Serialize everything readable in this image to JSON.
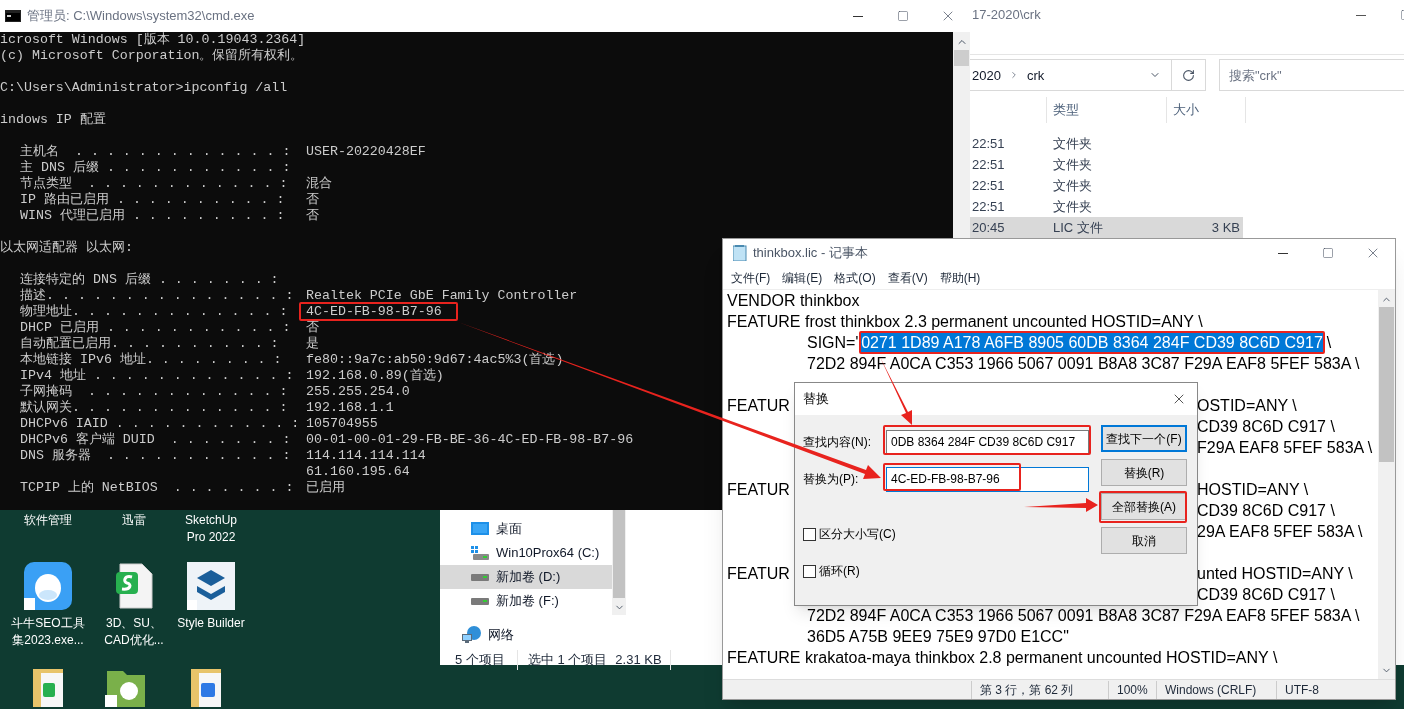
{
  "cmd_window": {
    "title": "管理员: C:\\Windows\\system32\\cmd.exe",
    "lines": [
      {
        "kind": "text",
        "text": "icrosoft Windows [版本 10.0.19043.2364]"
      },
      {
        "kind": "text",
        "text": "(c) Microsoft Corporation。保留所有权利。"
      },
      {
        "kind": "blank"
      },
      {
        "kind": "text",
        "text": "C:\\Users\\Administrator>ipconfig /all"
      },
      {
        "kind": "blank"
      },
      {
        "kind": "text",
        "text": "indows IP 配置"
      },
      {
        "kind": "blank"
      },
      {
        "kind": "field",
        "framed": false,
        "label": "主机名  . . . . . . . . . . . . . :",
        "value": "USER-20220428EF"
      },
      {
        "kind": "field",
        "framed": false,
        "label": "主 DNS 后缀 . . . . . . . . . . . :"
      },
      {
        "kind": "field",
        "framed": false,
        "label": "节点类型  . . . . . . . . . . . . :",
        "value": "混合"
      },
      {
        "kind": "field",
        "framed": false,
        "label": "IP 路由已启用 . . . . . . . . . . :",
        "value": "否"
      },
      {
        "kind": "field",
        "framed": false,
        "label": "WINS 代理已启用 . . . . . . . . . :",
        "value": "否"
      },
      {
        "kind": "blank"
      },
      {
        "kind": "text",
        "text": "以太网适配器 以太网:"
      },
      {
        "kind": "blank"
      },
      {
        "kind": "field",
        "framed": false,
        "label": "连接特定的 DNS 后缀 . . . . . . . :"
      },
      {
        "kind": "field",
        "framed": false,
        "label": "描述. . . . . . . . . . . . . . . :",
        "value": "Realtek PCIe GbE Family Controller"
      },
      {
        "kind": "field",
        "framed": true,
        "label": "物理地址. . . . . . . . . . . . . :",
        "value": "4C-ED-FB-98-B7-96"
      },
      {
        "kind": "field",
        "framed": false,
        "label": "DHCP 已启用 . . . . . . . . . . . :",
        "value": "否"
      },
      {
        "kind": "field",
        "framed": false,
        "label": "自动配置已启用. . . . . . . . . . :",
        "value": "是"
      },
      {
        "kind": "field",
        "framed": false,
        "label": "本地链接 IPv6 地址. . . . . . . . :",
        "value": "fe80::9a7c:ab50:9d67:4ac5%3(首选)"
      },
      {
        "kind": "field",
        "framed": false,
        "label": "IPv4 地址 . . . . . . . . . . . . :",
        "value": "192.168.0.89(首选)"
      },
      {
        "kind": "field",
        "framed": false,
        "label": "子网掩码  . . . . . . . . . . . . :",
        "value": "255.255.254.0"
      },
      {
        "kind": "field",
        "framed": false,
        "label": "默认网关. . . . . . . . . . . . . :",
        "value": "192.168.1.1"
      },
      {
        "kind": "field",
        "framed": false,
        "label": "DHCPv6 IAID . . . . . . . . . . . :",
        "value": "105704955"
      },
      {
        "kind": "field",
        "framed": false,
        "label": "DHCPv6 客户端 DUID  . . . . . . . :",
        "value": "00-01-00-01-29-FB-BE-36-4C-ED-FB-98-B7-96"
      },
      {
        "kind": "field",
        "framed": false,
        "label": "DNS 服务器  . . . . . . . . . . . :",
        "value": "114.114.114.114"
      },
      {
        "kind": "field",
        "framed": false,
        "value": "61.160.195.64"
      },
      {
        "kind": "field",
        "framed": false,
        "label": "TCPIP 上的 NetBIOS  . . . . . . . :",
        "value": "已启用"
      }
    ]
  },
  "explorer_window": {
    "title": "17-2020\\crk",
    "breadcrumb": [
      "2020",
      "crk"
    ],
    "search": {
      "placeholder": "搜索\"crk\""
    },
    "columns": [
      "类型",
      "大小"
    ],
    "rows": [
      {
        "time": "22:51",
        "type": "文件夹",
        "selected": false
      },
      {
        "time": "22:51",
        "type": "文件夹",
        "selected": false
      },
      {
        "time": "22:51",
        "type": "文件夹",
        "selected": false
      },
      {
        "time": "22:51",
        "type": "文件夹",
        "selected": false
      },
      {
        "time": "20:45",
        "type": "LIC 文件",
        "size": "3 KB",
        "selected": true
      }
    ],
    "nav": [
      {
        "label": "桌面",
        "kind": "desktop",
        "selected": false
      },
      {
        "label": "Win10Prox64 (C:)",
        "kind": "system-drive",
        "selected": false
      },
      {
        "label": "新加卷 (D:)",
        "kind": "drive",
        "selected": true
      },
      {
        "label": "新加卷 (F:)",
        "kind": "drive",
        "selected": false
      },
      {
        "label": "网络",
        "kind": "network",
        "selected": false
      }
    ],
    "status": [
      "5 个项目",
      "选中 1 个项目",
      "2.31 KB"
    ]
  },
  "notepad": {
    "title": "thinkbox.lic - 记事本",
    "menu": [
      "文件(F)",
      "编辑(E)",
      "格式(O)",
      "查看(V)",
      "帮助(H)"
    ],
    "lines": [
      {
        "kind": "text",
        "indented": false,
        "text": "VENDOR thinkbox"
      },
      {
        "kind": "text",
        "indented": false,
        "text": "FEATURE frost thinkbox 2.3 permanent uncounted HOSTID=ANY \\"
      },
      {
        "kind": "text",
        "indented": true,
        "text": "SIGN=\"",
        "selected_text": "0271 1D89 A178 A6FB 8905 60DB 8364 284F CD39 8C6D C917",
        "after": "\\"
      },
      {
        "kind": "text",
        "indented": true,
        "text": "72D2 894F A0CA C353 1966 5067 0091 B8A8 3C87 F29A EAF8 5FEF 583A \\"
      },
      {
        "kind": "covered"
      },
      {
        "kind": "split",
        "left": "FEATUR",
        "right": "OSTID=ANY \\"
      },
      {
        "kind": "split",
        "right": "CD39 8C6D C917 \\"
      },
      {
        "kind": "split",
        "right": "F29A EAF8 5FEF 583A \\"
      },
      {
        "kind": "covered"
      },
      {
        "kind": "split",
        "left": "FEATUR",
        "right": "HOSTID=ANY \\"
      },
      {
        "kind": "split",
        "right": "CD39 8C6D C917 \\"
      },
      {
        "kind": "split",
        "right": "29A EAF8 5FEF 583A \\"
      },
      {
        "kind": "covered"
      },
      {
        "kind": "split",
        "left": "FEATUR",
        "right": "unted HOSTID=ANY \\"
      },
      {
        "kind": "split",
        "right": "CD39 8C6D C917 \\"
      },
      {
        "kind": "text",
        "indented": true,
        "text": "72D2 894F A0CA C353 1966 5067 0091 B8A8 3C87 F29A EAF8 5FEF 583A \\"
      },
      {
        "kind": "text",
        "indented": true,
        "text": "36D5 A75B 9EE9 75E9 97D0 E1CC\""
      },
      {
        "kind": "text",
        "indented": false,
        "text": "FEATURE krakatoa-maya thinkbox 2.8 permanent uncounted HOSTID=ANY \\"
      }
    ],
    "status": [
      "第 3 行，第 62 列",
      "100%",
      "Windows (CRLF)",
      "UTF-8"
    ]
  },
  "replace_dialog": {
    "title": "替换",
    "find": {
      "label": "查找内容(N):",
      "value": "0DB 8364 284F CD39 8C6D C917"
    },
    "replace": {
      "label": "替换为(P):",
      "value": "4C-ED-FB-98-B7-96"
    },
    "buttons": [
      {
        "label": "查找下一个(F)",
        "focused": true
      },
      {
        "label": "替换(R)",
        "focused": false
      },
      {
        "label": "全部替换(A)",
        "focused": false
      },
      {
        "label": "取消",
        "focused": false
      }
    ],
    "options": [
      {
        "label": "区分大小写(C)",
        "checked": false
      },
      {
        "label": "循环(R)",
        "checked": false
      }
    ]
  },
  "desktop_icons": [
    {
      "label": [
        "软件管理"
      ],
      "kind": "hidden"
    },
    {
      "label": [
        "迅雷"
      ],
      "kind": "hidden"
    },
    {
      "label": [
        "SketchUp",
        "Pro 2022"
      ],
      "kind": "hidden"
    },
    {
      "label": [
        "斗牛SEO工具",
        "集2023.exe..."
      ],
      "kind": "app"
    },
    {
      "label": [
        "3D、SU、",
        "CAD优化..."
      ],
      "kind": "sheet"
    },
    {
      "label": [
        "Style Builder"
      ],
      "kind": "logo"
    }
  ]
}
